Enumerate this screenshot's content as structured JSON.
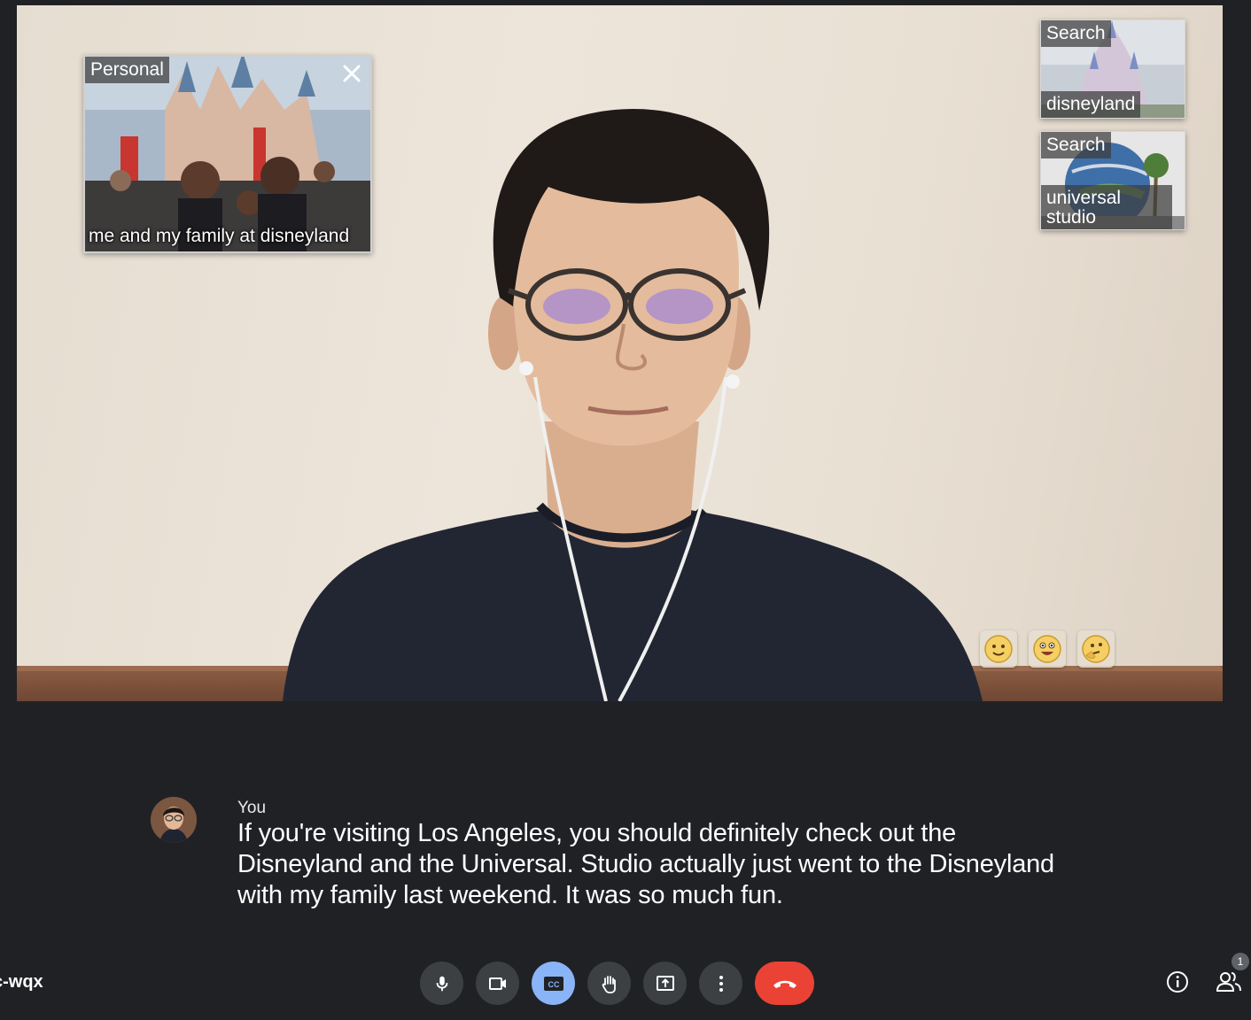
{
  "personal_card": {
    "tag": "Personal",
    "caption": "me and my family at disneyland"
  },
  "search_cards": [
    {
      "tag": "Search",
      "query": "disneyland"
    },
    {
      "tag": "Search",
      "query": "universal studio"
    }
  ],
  "captions": {
    "speaker": "You",
    "text": "If you're visiting Los Angeles, you should definitely check out the Disneyland and the Universal. Studio actually just went to the Disneyland with my family last weekend. It was so much fun."
  },
  "meeting": {
    "code": "c-wqx",
    "participants_count": "1"
  },
  "controls": {
    "captions_label": "CC"
  },
  "reactions": [
    "smiling-face-icon",
    "grinning-face-icon",
    "thinking-face-icon"
  ],
  "colors": {
    "background": "#202124",
    "control": "#3c4043",
    "captions_active": "#8ab4f8",
    "end_call": "#ea4335"
  }
}
